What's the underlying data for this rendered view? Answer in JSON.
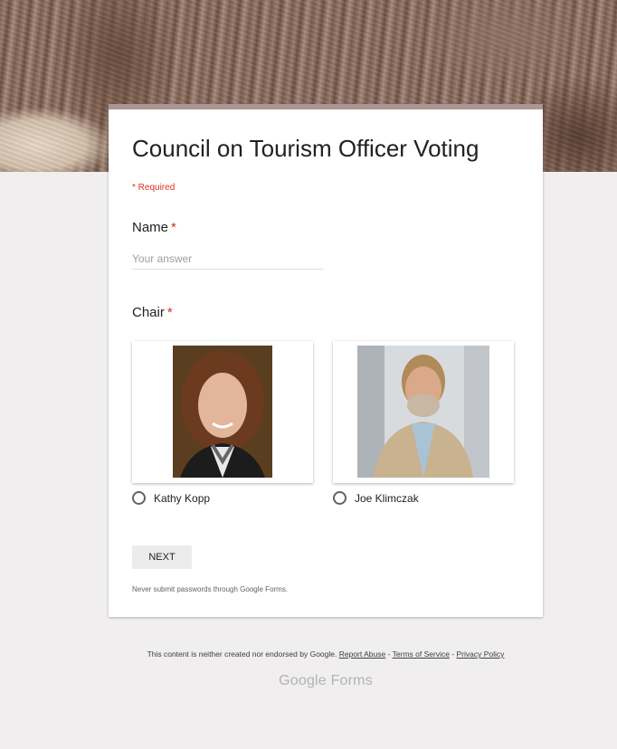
{
  "form": {
    "title": "Council on Tourism Officer Voting",
    "required_note": "* Required",
    "accent_color": "#ab9694"
  },
  "questions": {
    "name": {
      "label": "Name",
      "required_mark": "*",
      "placeholder": "Your answer"
    },
    "chair": {
      "label": "Chair",
      "required_mark": "*",
      "options": [
        {
          "label": "Kathy Kopp",
          "selected": false
        },
        {
          "label": "Joe Klimczak",
          "selected": false
        }
      ]
    }
  },
  "actions": {
    "next_label": "NEXT"
  },
  "notes": {
    "password_warning": "Never submit passwords through Google Forms."
  },
  "footer": {
    "disclaimer": "This content is neither created nor endorsed by Google.",
    "links": [
      "Report Abuse",
      "Terms of Service",
      "Privacy Policy"
    ],
    "separator": " - ",
    "brand_google": "Google",
    "brand_forms": "Forms"
  }
}
